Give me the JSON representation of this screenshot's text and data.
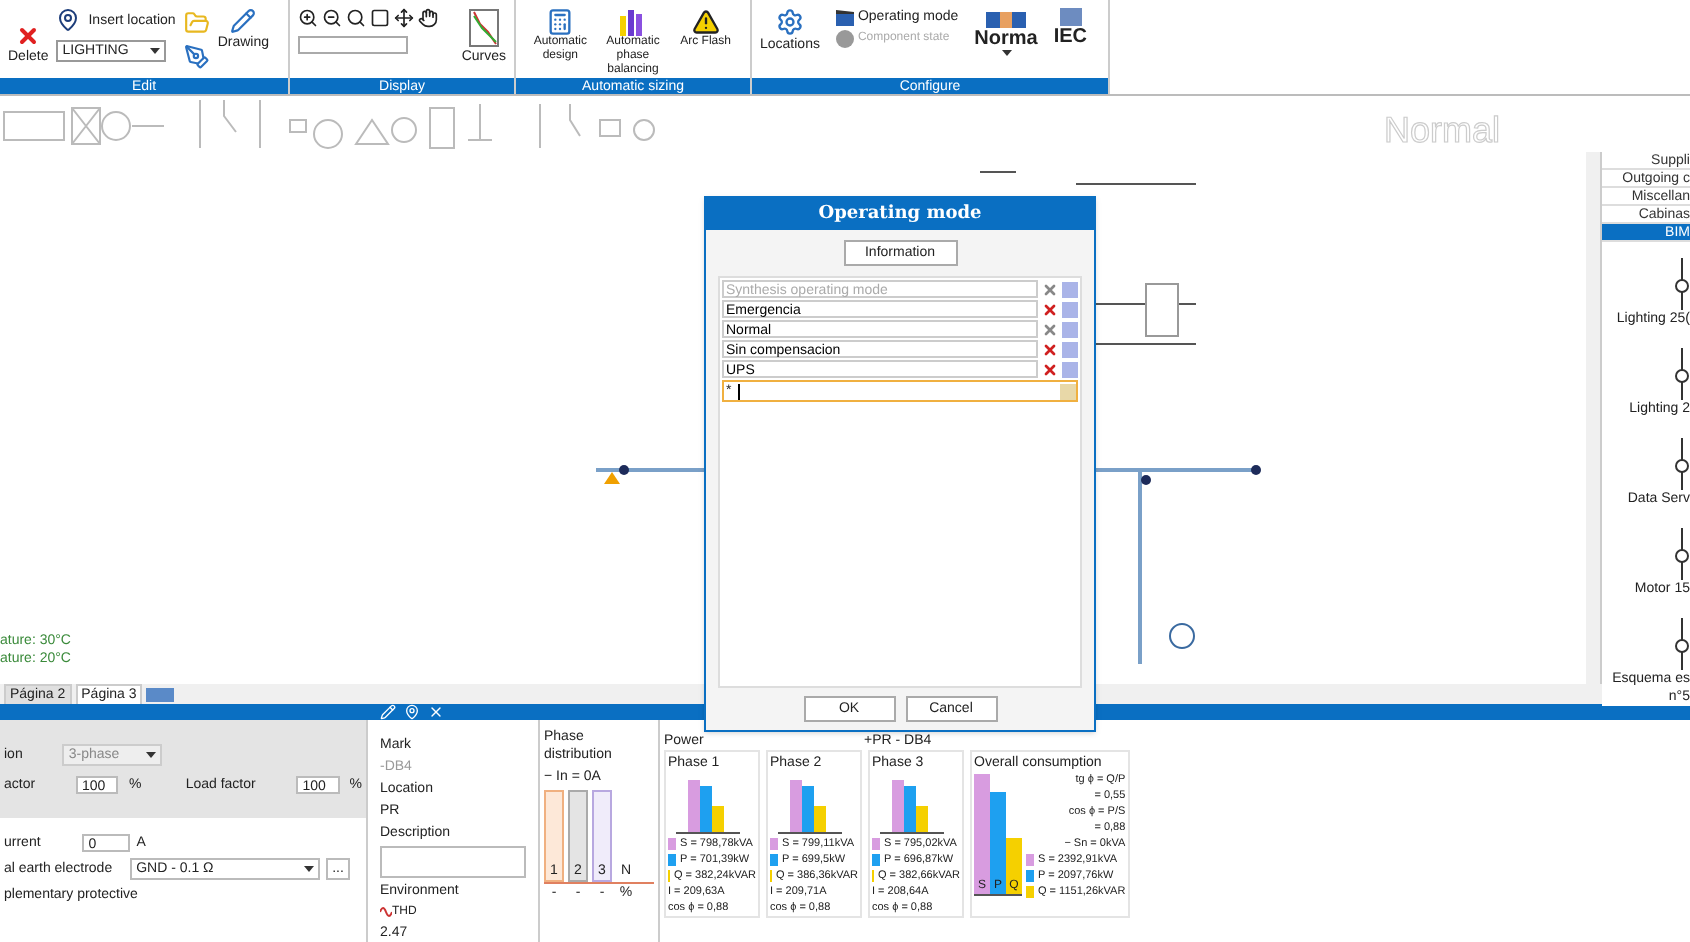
{
  "ribbon": {
    "edit": {
      "label": "Edit",
      "delete": "Delete",
      "insert_location": "Insert location",
      "location_select": "LIGHTING",
      "drawing": "Drawing"
    },
    "display": {
      "label": "Display",
      "curves": "Curves"
    },
    "sizing": {
      "label": "Automatic sizing",
      "buttons": [
        "Automatic design",
        "Automatic phase balancing",
        "Arc Flash"
      ]
    },
    "configure": {
      "label": "Configure",
      "locations": "Locations",
      "operating_mode": "Operating mode",
      "component_state": {
        "label": "Component state",
        "disabled": true
      },
      "norma": "Norma",
      "iec": "IEC"
    }
  },
  "canvas": {
    "mode_label": "Normal",
    "notes": [
      "ature: 30°C",
      "ature: 20°C"
    ]
  },
  "library": {
    "tabs": [
      {
        "label": "Suppli",
        "selected": false
      },
      {
        "label": "Outgoing c",
        "selected": false
      },
      {
        "label": "Miscellan",
        "selected": false
      },
      {
        "label": "Cabinas",
        "selected": false
      },
      {
        "label": "BIM",
        "selected": true
      }
    ],
    "items": [
      "Lighting 25(",
      "Lighting 2",
      "Data Serv",
      "Motor 15",
      "Esquema es n°5"
    ]
  },
  "page_tabs": [
    {
      "label": "Página 2",
      "selected": false
    },
    {
      "label": "Página 3",
      "selected": true
    }
  ],
  "dialog": {
    "title": "Operating mode",
    "info_button": "Information",
    "modes": [
      {
        "name": "Synthesis operating mode",
        "deletable": false,
        "synthesis": true
      },
      {
        "name": "Emergencia",
        "deletable": true,
        "synthesis": false
      },
      {
        "name": "Normal",
        "deletable": false,
        "synthesis": false
      },
      {
        "name": "Sin compensacion",
        "deletable": true,
        "synthesis": false
      },
      {
        "name": "UPS",
        "deletable": true,
        "synthesis": false
      }
    ],
    "new_row_marker": "*",
    "buttons": [
      "OK",
      "Cancel"
    ]
  },
  "properties": {
    "connection": {
      "label": "ion",
      "value": "3-phase",
      "disabled": true
    },
    "factor": {
      "label": "actor",
      "value": "100",
      "unit": "%"
    },
    "load_factor": {
      "label": "Load factor",
      "value": "100",
      "unit": "%"
    },
    "current": {
      "label": "urrent",
      "value": "0",
      "unit": "A"
    },
    "earth": {
      "label": "al earth electrode",
      "value": "GND - 0.1 Ω",
      "more": "..."
    },
    "protective": "plementary protective"
  },
  "info": {
    "mark_label": "Mark",
    "mark": "-DB4",
    "location_label": "Location",
    "location": "PR",
    "description_label": "Description",
    "environment_label": "Environment",
    "thd": "THD",
    "thd_value": "2.47"
  },
  "phase_distribution": {
    "title": "Phase distribution",
    "in_label": "− In = 0A",
    "bars": [
      {
        "label": "1",
        "reading": "-"
      },
      {
        "label": "2",
        "reading": "-"
      },
      {
        "label": "3",
        "reading": "-"
      },
      {
        "label": "N",
        "reading": "%"
      }
    ]
  },
  "power": {
    "title": "Power",
    "subtitle": "+PR - DB4",
    "phases": [
      {
        "title": "Phase 1",
        "lines": [
          {
            "text": "S = 798,78kVA",
            "color": "#d89ce0"
          },
          {
            "text": "P = 701,39kW",
            "color": "#1ea0f0"
          },
          {
            "text": "Q = 382,24kVAR",
            "color": "#f5d000"
          }
        ],
        "extra": [
          "I = 209,63A",
          "cos ϕ = 0,88"
        ]
      },
      {
        "title": "Phase 2",
        "lines": [
          {
            "text": "S = 799,11kVA",
            "color": "#d89ce0"
          },
          {
            "text": "P = 699,5kW",
            "color": "#1ea0f0"
          },
          {
            "text": "Q = 386,36kVAR",
            "color": "#f5d000"
          }
        ],
        "extra": [
          "I = 209,71A",
          "cos ϕ = 0,88"
        ]
      },
      {
        "title": "Phase 3",
        "lines": [
          {
            "text": "S = 795,02kVA",
            "color": "#d89ce0"
          },
          {
            "text": "P = 696,87kW",
            "color": "#1ea0f0"
          },
          {
            "text": "Q = 382,66kVAR",
            "color": "#f5d000"
          }
        ],
        "extra": [
          "I = 208,64A",
          "cos ϕ = 0,88"
        ]
      }
    ],
    "overall": {
      "title": "Overall consumption",
      "bar_labels": [
        "S",
        "P",
        "Q"
      ],
      "ratios": [
        "tg ϕ = Q/P",
        "= 0,55",
        "cos ϕ = P/S",
        "= 0,88",
        "− Sn = 0kVA"
      ],
      "lines": [
        {
          "text": "S = 2392,91kVA",
          "color": "#d89ce0"
        },
        {
          "text": "P = 2097,76kW",
          "color": "#1ea0f0"
        },
        {
          "text": "Q = 1151,26kVAR",
          "color": "#f5d000"
        }
      ]
    }
  }
}
